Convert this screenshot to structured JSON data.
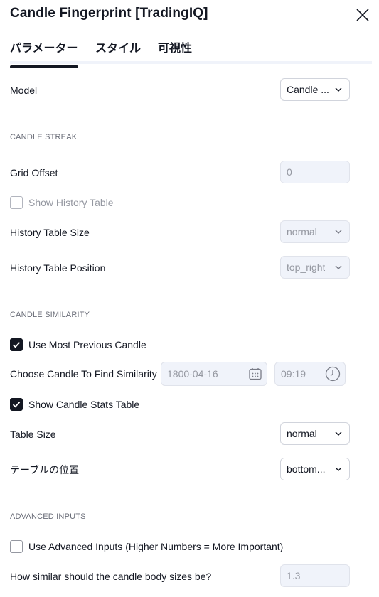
{
  "dialog": {
    "title": "Candle Fingerprint [TradingIQ]",
    "close_icon": "close-icon"
  },
  "tabs": [
    {
      "label": "パラメーター",
      "active": true
    },
    {
      "label": "スタイル",
      "active": false
    },
    {
      "label": "可視性",
      "active": false
    }
  ],
  "model": {
    "label": "Model",
    "value": "Candle ..."
  },
  "sections": {
    "candle_streak": "CANDLE STREAK",
    "candle_similarity": "CANDLE SIMILARITY",
    "advanced_inputs": "ADVANCED INPUTS"
  },
  "grid_offset": {
    "label": "Grid Offset",
    "value": "0"
  },
  "show_history_table": {
    "label": "Show History Table",
    "checked": false,
    "disabled": true
  },
  "history_table_size": {
    "label": "History Table Size",
    "value": "normal"
  },
  "history_table_position": {
    "label": "History Table Position",
    "value": "top_right"
  },
  "use_most_previous_candle": {
    "label": "Use Most Previous Candle",
    "checked": true
  },
  "choose_candle": {
    "label": "Choose Candle To Find Similarity",
    "date": "1800-04-16",
    "time": "09:19"
  },
  "show_candle_stats_table": {
    "label": "Show Candle Stats Table",
    "checked": true
  },
  "table_size": {
    "label": "Table Size",
    "value": "normal"
  },
  "table_position": {
    "label": "テーブルの位置",
    "value": "bottom..."
  },
  "use_advanced_inputs": {
    "label": "Use Advanced Inputs (Higher Numbers = More Important)",
    "checked": false
  },
  "body_size_similarity": {
    "label": "How similar should the candle body sizes be?",
    "value": "1.3"
  }
}
